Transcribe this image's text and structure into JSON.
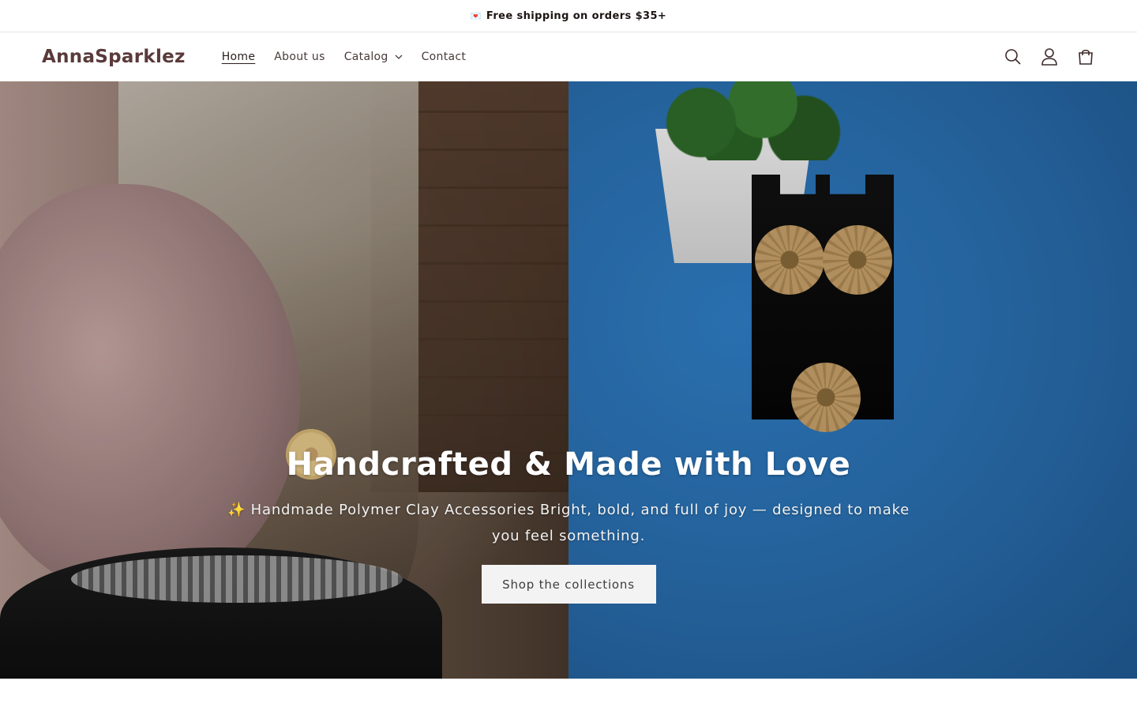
{
  "announcement": {
    "icon": "heart-letter-icon",
    "text": "Free shipping on orders $35+"
  },
  "header": {
    "logo": "AnnaSparklez",
    "nav": [
      {
        "label": "Home",
        "active": true
      },
      {
        "label": "About us",
        "active": false
      },
      {
        "label": "Catalog",
        "active": false,
        "has_dropdown": true
      },
      {
        "label": "Contact",
        "active": false
      }
    ],
    "icons": [
      "search-icon",
      "account-icon",
      "cart-icon"
    ]
  },
  "hero": {
    "title": "Handcrafted & Made with Love",
    "subtitle": "✨ Handmade Polymer Clay Accessories Bright, bold, and full of joy — designed to make you feel something.",
    "button_label": "Shop the collections"
  },
  "colors": {
    "logo": "#5a3a3a",
    "nav_text": "#4a3a3a",
    "button_bg": "#f3f3f3",
    "hero_right_bg": "#2a6fb0"
  }
}
